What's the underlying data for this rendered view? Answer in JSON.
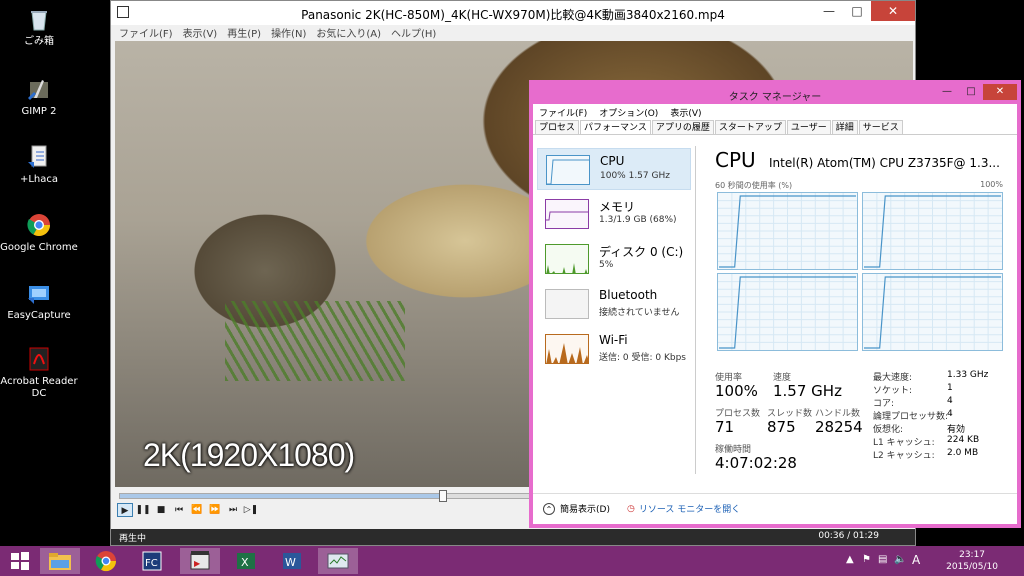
{
  "desktop": {
    "icons": [
      {
        "label": "ごみ箱",
        "icon": "recycle-bin-icon"
      },
      {
        "label": "GIMP 2",
        "icon": "gimp-icon"
      },
      {
        "label": "+Lhaca",
        "icon": "lhaca-icon"
      },
      {
        "label": "Google Chrome",
        "icon": "chrome-icon"
      },
      {
        "label": "EasyCapture",
        "icon": "easycapture-icon"
      },
      {
        "label": "Acrobat Reader DC",
        "icon": "acrobat-icon"
      }
    ]
  },
  "player": {
    "title": "Panasonic 2K(HC-850M)_4K(HC-WX970M)比較@4K動画3840x2160.mp4",
    "menu": [
      "ファイル(F)",
      "表示(V)",
      "再生(P)",
      "操作(N)",
      "お気に入り(A)",
      "ヘルプ(H)"
    ],
    "caption": "2K(1920X1080)",
    "status": "再生中",
    "time": "00:36 / 01:29",
    "progress_fraction": 0.41
  },
  "taskmgr": {
    "title": "タスク マネージャー",
    "menu": [
      "ファイル(F)",
      "オプション(O)",
      "表示(V)"
    ],
    "tabs": [
      "プロセス",
      "パフォーマンス",
      "アプリの履歴",
      "スタートアップ",
      "ユーザー",
      "詳細",
      "サービス"
    ],
    "active_tab": "パフォーマンス",
    "resources": [
      {
        "name": "CPU",
        "sub": "100% 1.57 GHz",
        "color": "#4a94c8",
        "selected": true
      },
      {
        "name": "メモリ",
        "sub": "1.3/1.9 GB (68%)",
        "color": "#8b3ca6"
      },
      {
        "name": "ディスク 0 (C:)",
        "sub": "5%",
        "color": "#4e9a2c"
      },
      {
        "name": "Bluetooth",
        "sub": "接続されていません",
        "color": "#aaaaaa"
      },
      {
        "name": "Wi-Fi",
        "sub": "送信: 0  受信: 0 Kbps",
        "color": "#b86a1e"
      }
    ],
    "detail": {
      "header": "CPU",
      "model": "Intel(R) Atom(TM) CPU Z3735F@ 1.3...",
      "axis_left": "60 秒間の使用率 (%)",
      "axis_right": "100%",
      "usage_label": "使用率",
      "usage": "100%",
      "speed_label": "速度",
      "speed": "1.57 GHz",
      "proc_label": "プロセス数",
      "proc": "71",
      "threads_label": "スレッド数",
      "threads": "875",
      "handles_label": "ハンドル数",
      "handles": "28254",
      "uptime_label": "稼働時間",
      "uptime": "4:07:02:28",
      "specs": [
        {
          "k": "最大速度:",
          "v": "1.33 GHz"
        },
        {
          "k": "ソケット:",
          "v": "1"
        },
        {
          "k": "コア:",
          "v": "4"
        },
        {
          "k": "論理プロセッサ数:",
          "v": "4"
        },
        {
          "k": "仮想化:",
          "v": "有効"
        },
        {
          "k": "L1 キャッシュ:",
          "v": "224 KB"
        },
        {
          "k": "L2 キャッシュ:",
          "v": "2.0 MB"
        }
      ]
    },
    "footer_less": "簡易表示(D)",
    "footer_monitor": "リソース モニターを開く"
  },
  "taskbar": {
    "items": [
      "start-icon",
      "explorer-icon",
      "chrome-icon",
      "fastcopy-icon",
      "media-player-icon",
      "excel-icon",
      "word-icon",
      "task-manager-icon"
    ],
    "clock_time": "23:17",
    "clock_date": "2015/05/10",
    "ime": "A"
  }
}
